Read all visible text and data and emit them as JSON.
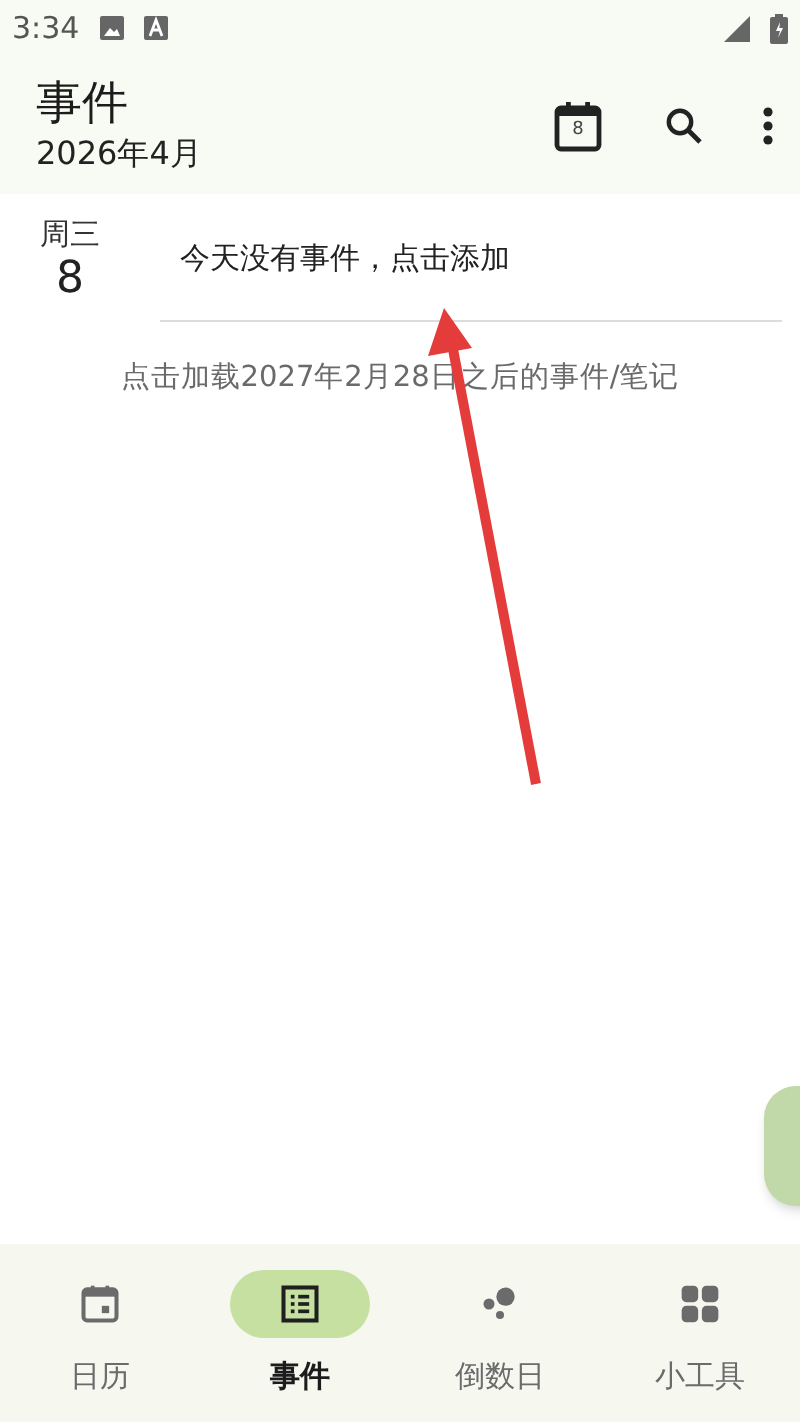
{
  "status_bar": {
    "time": "3:34"
  },
  "app_bar": {
    "title": "事件",
    "subtitle": "2026年4月",
    "calendar_day": "8"
  },
  "day": {
    "weekday": "周三",
    "date": "8",
    "empty_message": "今天没有事件，点击添加"
  },
  "load_more": "点击加载2027年2月28日之后的事件/笔记",
  "nav": [
    {
      "label": "日历",
      "kind": "calendar",
      "selected": false
    },
    {
      "label": "事件",
      "kind": "list",
      "selected": true
    },
    {
      "label": "倒数日",
      "kind": "dots",
      "selected": false
    },
    {
      "label": "小工具",
      "kind": "grid",
      "selected": false
    }
  ]
}
